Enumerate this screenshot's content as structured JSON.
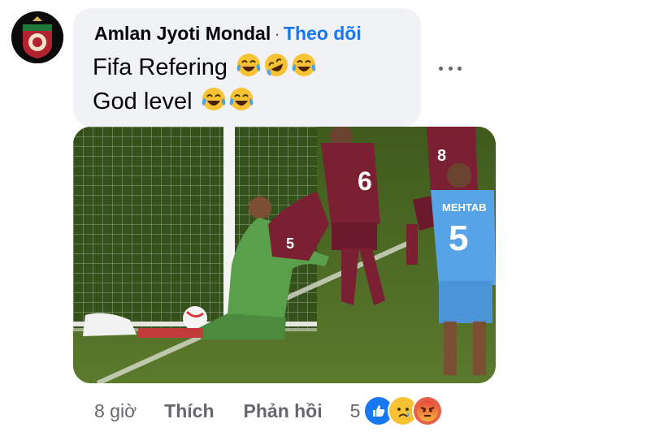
{
  "comment": {
    "author_name": "Amlan Jyoti Mondal",
    "separator": "·",
    "follow_label": "Theo dõi",
    "lines": [
      "Fifa Refering",
      "God level"
    ]
  },
  "photo": {
    "player_names": [
      "MEHTAB"
    ],
    "player_numbers": [
      "6",
      "8",
      "5",
      "5"
    ]
  },
  "actions": {
    "time": "8 giờ",
    "like_label": "Thích",
    "reply_label": "Phản hồi",
    "reaction_count": "5",
    "reactions": [
      "like-icon",
      "sad-icon",
      "angry-icon"
    ]
  },
  "colors": {
    "follow": "#1877f2",
    "bubble": "#f0f2f5",
    "secondary_text": "#65676b",
    "qatar_maroon": "#7b1f32",
    "india_blue": "#56a3e6",
    "keeper_green": "#5aa04a",
    "pitch": "#4c6a24"
  }
}
